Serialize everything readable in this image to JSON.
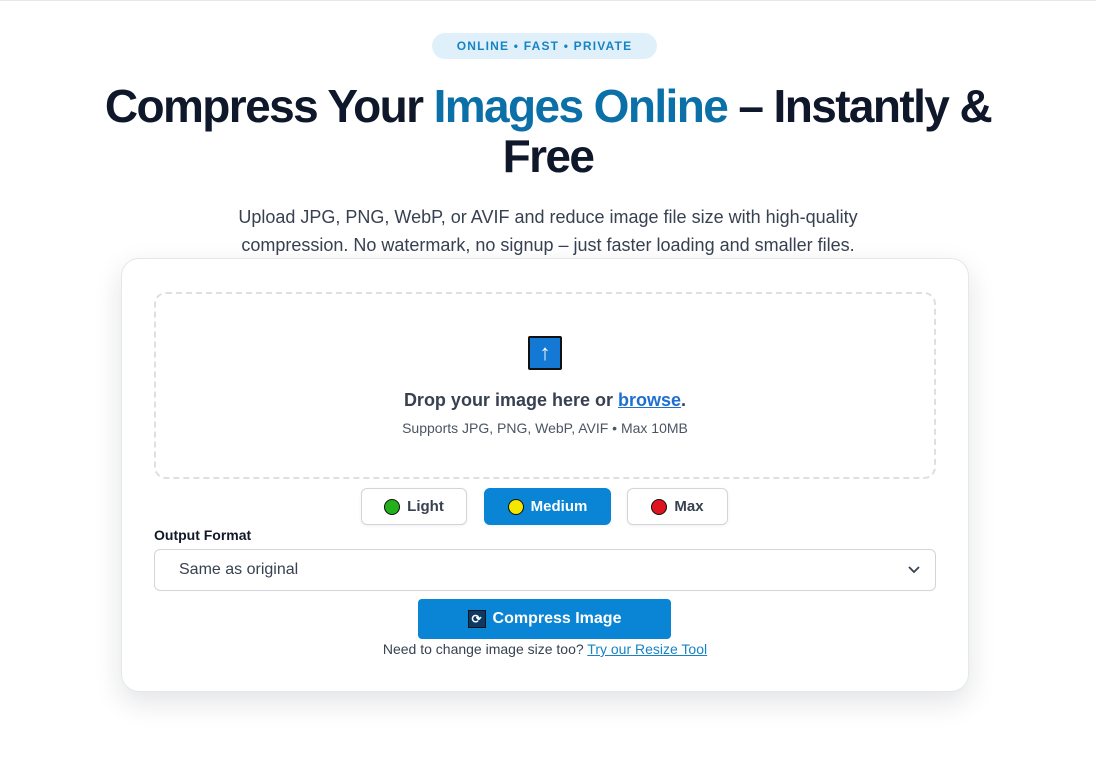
{
  "badge": "ONLINE • FAST • PRIVATE",
  "hero": {
    "title_before": "Compress Your ",
    "title_accent": "Images Online",
    "title_after": " – Instantly & Free",
    "subtitle": "Upload JPG, PNG, WebP, or AVIF and reduce image file size with high-quality compression. No watermark, no signup – just faster loading and smaller files."
  },
  "dropzone": {
    "icon": "upload-arrow-icon",
    "text": "Drop your image here or ",
    "browse_link": "browse",
    "text_end": ".",
    "hint": "Supports JPG, PNG, WebP, AVIF • Max 10MB"
  },
  "levels": [
    {
      "label": "Light",
      "color": "#22b11a",
      "active": false
    },
    {
      "label": "Medium",
      "color": "#f5e600",
      "active": true
    },
    {
      "label": "Max",
      "color": "#e0141e",
      "active": false
    }
  ],
  "output_format": {
    "label": "Output Format",
    "selected": "Same as original"
  },
  "compress_button": {
    "label": "Compress Image",
    "icon": "refresh-icon"
  },
  "resize_note": {
    "text": "Need to change image size too? ",
    "link": "Try our Resize Tool"
  },
  "colors": {
    "accent": "#0a84d4",
    "title_accent": "#0b6fa8"
  }
}
